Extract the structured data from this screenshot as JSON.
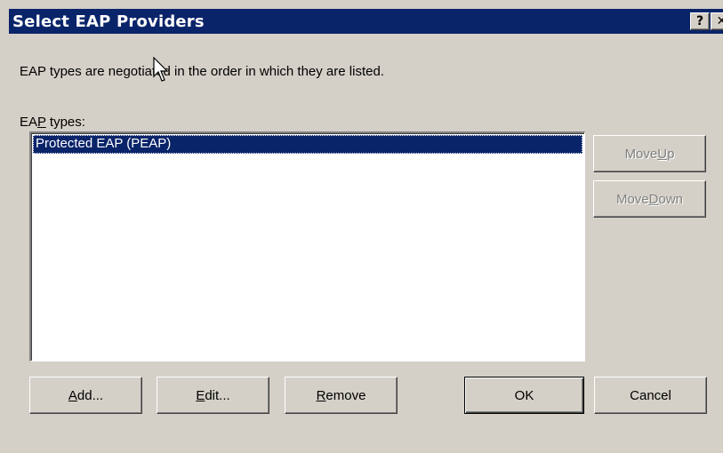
{
  "dialog": {
    "title": "Select EAP Providers",
    "help_glyph": "?",
    "close_glyph": "✕"
  },
  "hint": "EAP types are negotiated in the order in which they are listed.",
  "eap_types_label": {
    "before": "EA",
    "mnemonic": "P",
    "after": " types:"
  },
  "eap_types": [
    {
      "label": "Protected EAP (PEAP)",
      "selected": true
    }
  ],
  "buttons": {
    "move_up": {
      "before": "Move ",
      "mnemonic": "U",
      "after": "p",
      "enabled": false
    },
    "move_down": {
      "before": "Move ",
      "mnemonic": "D",
      "after": "own",
      "enabled": false
    },
    "add": {
      "before": "",
      "mnemonic": "A",
      "after": "dd..."
    },
    "edit": {
      "before": "",
      "mnemonic": "E",
      "after": "dit..."
    },
    "remove": {
      "before": "",
      "mnemonic": "R",
      "after": "emove"
    },
    "ok": {
      "label": "OK"
    },
    "cancel": {
      "label": "Cancel"
    }
  },
  "colors": {
    "face": "#d4d0c8",
    "titlebar": "#0a246a",
    "selection": "#0a246a"
  }
}
